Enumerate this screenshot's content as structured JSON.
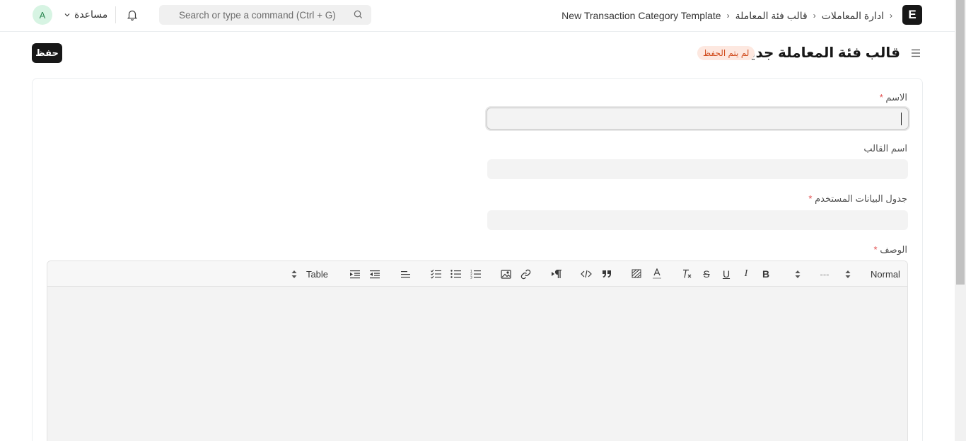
{
  "navbar": {
    "logo_letter": "E",
    "breadcrumbs": [
      "ادارة المعاملات",
      "قالب فئة المعاملة",
      "New Transaction Category Template"
    ],
    "breadcrumb_sep": "›",
    "search_placeholder": "Search or type a command (Ctrl + G)",
    "help_label": "مساعدة",
    "avatar_letter": "A"
  },
  "page": {
    "title": "قالب فئة المعاملة جديد",
    "status_badge": "لم يتم الحفظ",
    "save_label": "حفظ"
  },
  "form": {
    "name_label": "الاسم",
    "template_name_label": "اسم القالب",
    "doctype_label": "جدول البيانات المستخدم",
    "description_label": "الوصف",
    "required_mark": "*"
  },
  "editor": {
    "paragraph_style": "Normal",
    "font_size": "---",
    "table_label": "Table"
  },
  "colors": {
    "primary_dark": "#171717",
    "badge_bg": "#fde8e0",
    "badge_text": "#d14f21",
    "input_bg": "#f3f3f3",
    "required": "#e24c4c"
  }
}
